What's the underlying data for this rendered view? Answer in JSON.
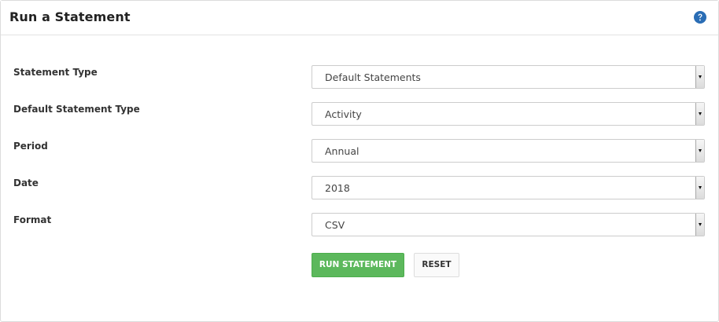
{
  "panel": {
    "title": "Run a Statement",
    "help_icon": "question-circle-icon",
    "help_color": "#2a6db5"
  },
  "form": {
    "fields": [
      {
        "label": "Statement Type",
        "value": "Default Statements"
      },
      {
        "label": "Default Statement Type",
        "value": "Activity"
      },
      {
        "label": "Period",
        "value": "Annual"
      },
      {
        "label": "Date",
        "value": "2018"
      },
      {
        "label": "Format",
        "value": "CSV"
      }
    ]
  },
  "actions": {
    "run_label": "RUN STATEMENT",
    "run_color": "#5cb85c",
    "reset_label": "RESET"
  }
}
